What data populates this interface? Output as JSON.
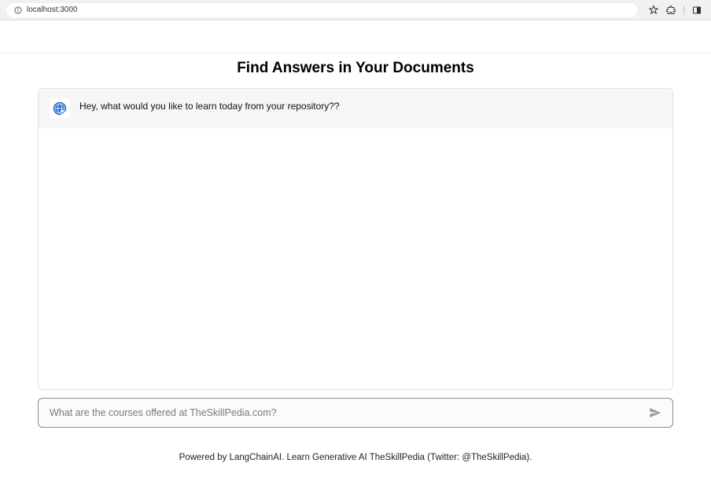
{
  "browser": {
    "url": "localhost:3000"
  },
  "page": {
    "title": "Find Answers in Your Documents"
  },
  "chat": {
    "bot_message": "Hey, what would you like to learn today from your repository??"
  },
  "input": {
    "placeholder": "What are the courses offered at TheSkillPedia.com?"
  },
  "footer": {
    "text": "Powered by LangChainAI. Learn Generative AI TheSkillPedia (Twitter: @TheSkillPedia)."
  }
}
